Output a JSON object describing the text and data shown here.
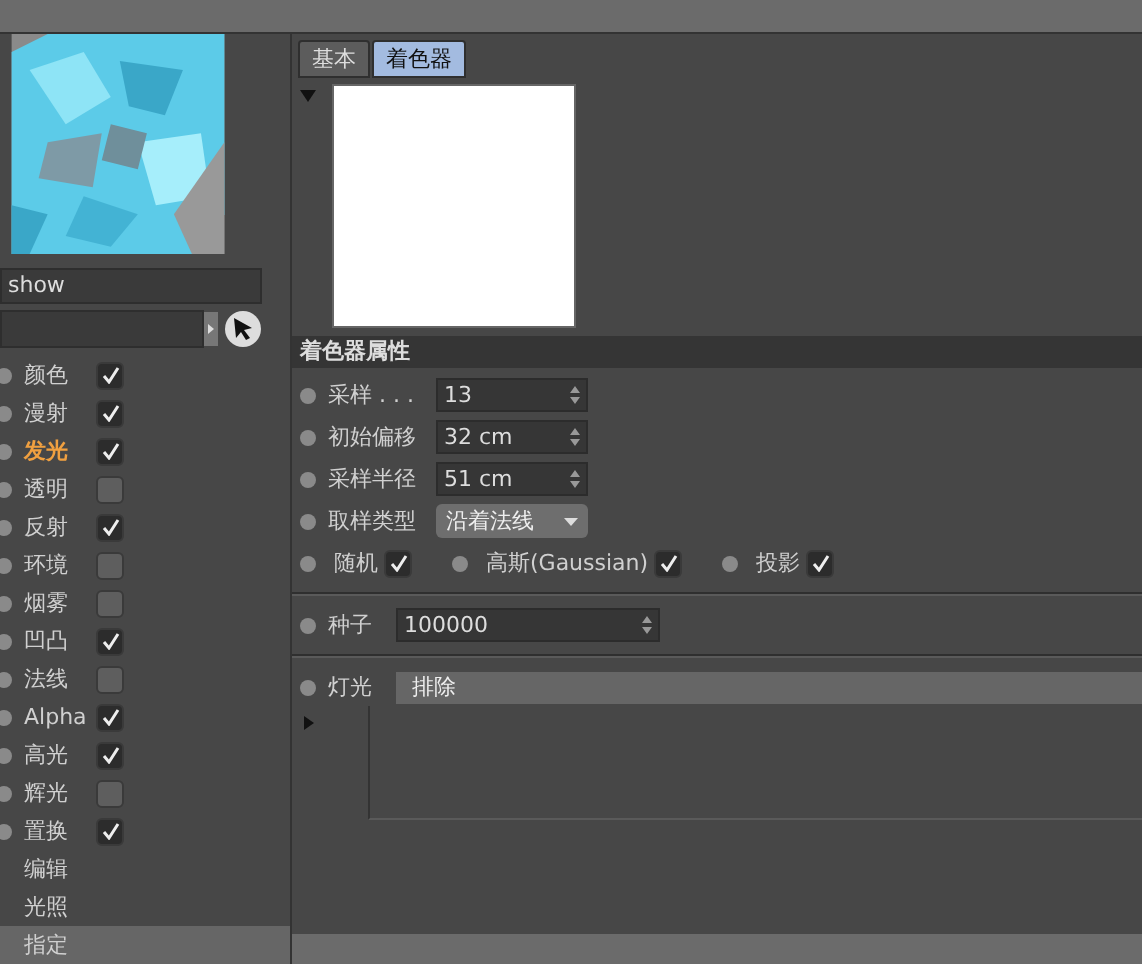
{
  "tabs": [
    {
      "label": "基本",
      "selected": false
    },
    {
      "label": "着色器",
      "selected": true
    }
  ],
  "material_name": "show",
  "channels": [
    {
      "kind": "channel",
      "label": "颜色",
      "checked": true,
      "selected": false
    },
    {
      "kind": "channel",
      "label": "漫射",
      "checked": true,
      "selected": false
    },
    {
      "kind": "channel",
      "label": "发光",
      "checked": true,
      "selected": true
    },
    {
      "kind": "channel",
      "label": "透明",
      "checked": false,
      "selected": false
    },
    {
      "kind": "channel",
      "label": "反射",
      "checked": true,
      "selected": false
    },
    {
      "kind": "channel",
      "label": "环境",
      "checked": false,
      "selected": false
    },
    {
      "kind": "channel",
      "label": "烟雾",
      "checked": false,
      "selected": false
    },
    {
      "kind": "channel",
      "label": "凹凸",
      "checked": true,
      "selected": false
    },
    {
      "kind": "channel",
      "label": "法线",
      "checked": false,
      "selected": false
    },
    {
      "kind": "channel",
      "label": "Alpha",
      "checked": true,
      "selected": false
    },
    {
      "kind": "channel",
      "label": "高光",
      "checked": true,
      "selected": false
    },
    {
      "kind": "channel",
      "label": "辉光",
      "checked": false,
      "selected": false
    },
    {
      "kind": "channel",
      "label": "置换",
      "checked": true,
      "selected": false
    },
    {
      "kind": "page",
      "label": "编辑",
      "selected": false
    },
    {
      "kind": "page",
      "label": "光照",
      "selected": false
    },
    {
      "kind": "page",
      "label": "指定",
      "selected": true
    }
  ],
  "section_title": "着色器属性",
  "properties": [
    {
      "kind": "spinner",
      "label": "采样 . . .",
      "value": "13"
    },
    {
      "kind": "spinner",
      "label": "初始偏移",
      "value": "32 cm"
    },
    {
      "kind": "spinner",
      "label": "采样半径",
      "value": "51 cm"
    },
    {
      "kind": "dropdown",
      "label": "取样类型",
      "value": "沿着法线"
    },
    {
      "kind": "checks",
      "items": [
        {
          "label": "随机",
          "checked": true
        },
        {
          "label": "高斯(Gaussian)",
          "checked": true
        },
        {
          "label": "投影",
          "checked": true
        }
      ]
    }
  ],
  "seed": {
    "label": "种子",
    "value": "100000"
  },
  "lights": {
    "label": "灯光",
    "mode": "排除"
  }
}
